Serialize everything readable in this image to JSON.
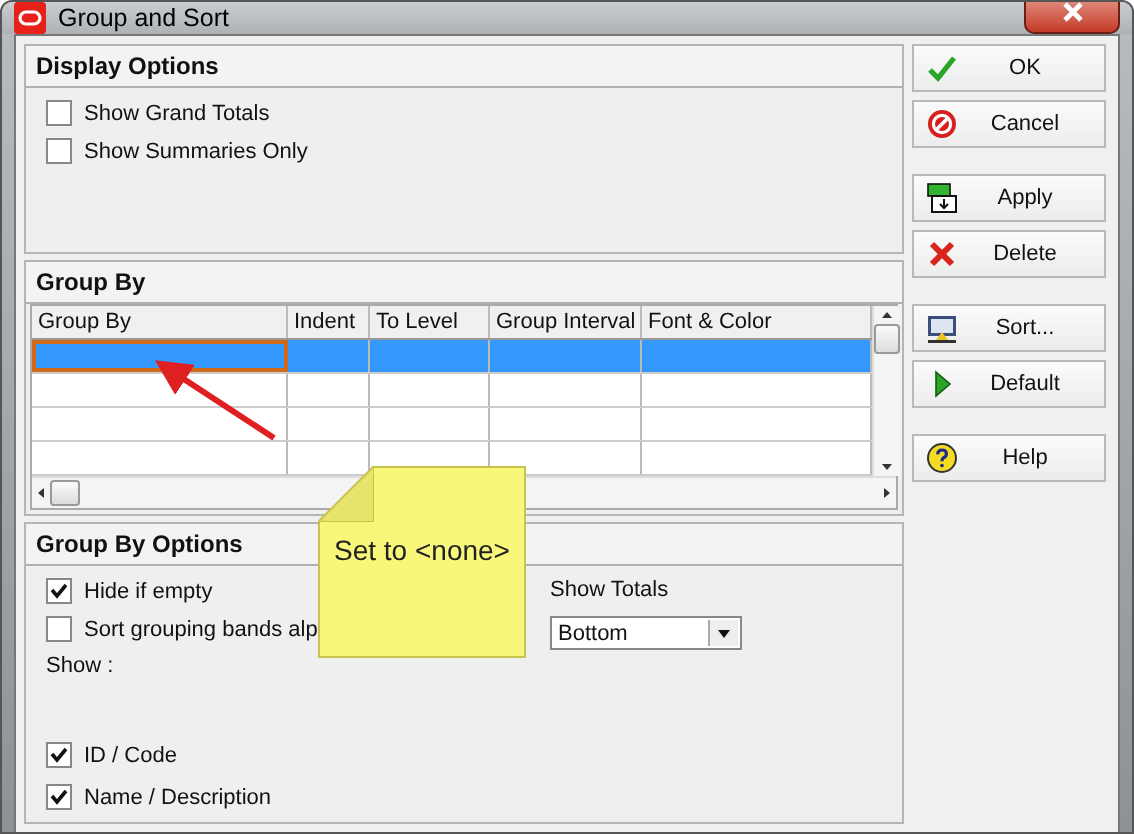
{
  "window": {
    "title": "Group and Sort"
  },
  "display_options": {
    "title": "Display Options",
    "checkboxes": [
      {
        "label": "Show Grand Totals",
        "checked": false
      },
      {
        "label": "Show Summaries Only",
        "checked": false
      }
    ]
  },
  "group_by": {
    "title": "Group By",
    "columns": [
      "Group By",
      "Indent",
      "To Level",
      "Group Interval",
      "Font & Color"
    ],
    "rows": [
      {
        "selected": true
      },
      {
        "selected": false
      },
      {
        "selected": false
      },
      {
        "selected": false
      }
    ]
  },
  "group_by_options": {
    "title": "Group By Options",
    "checkboxes": [
      {
        "label": "Hide if empty",
        "checked": true
      },
      {
        "label": "Sort grouping bands alp",
        "checked": false
      }
    ],
    "show_label": "Show :",
    "show_items": [
      {
        "label": "ID / Code",
        "checked": true
      },
      {
        "label": "Name / Description",
        "checked": true
      }
    ],
    "show_totals": {
      "label": "Show Totals",
      "value": "Bottom"
    }
  },
  "button_groups": [
    [
      {
        "kind": "ok",
        "label": "OK"
      },
      {
        "kind": "cancel",
        "label": "Cancel"
      }
    ],
    [
      {
        "kind": "apply",
        "label": "Apply"
      },
      {
        "kind": "delete",
        "label": "Delete"
      }
    ],
    [
      {
        "kind": "sort",
        "label": "Sort..."
      },
      {
        "kind": "default",
        "label": "Default"
      }
    ],
    [
      {
        "kind": "help",
        "label": "Help"
      }
    ]
  ],
  "callout": {
    "text": "Set to <none>"
  }
}
